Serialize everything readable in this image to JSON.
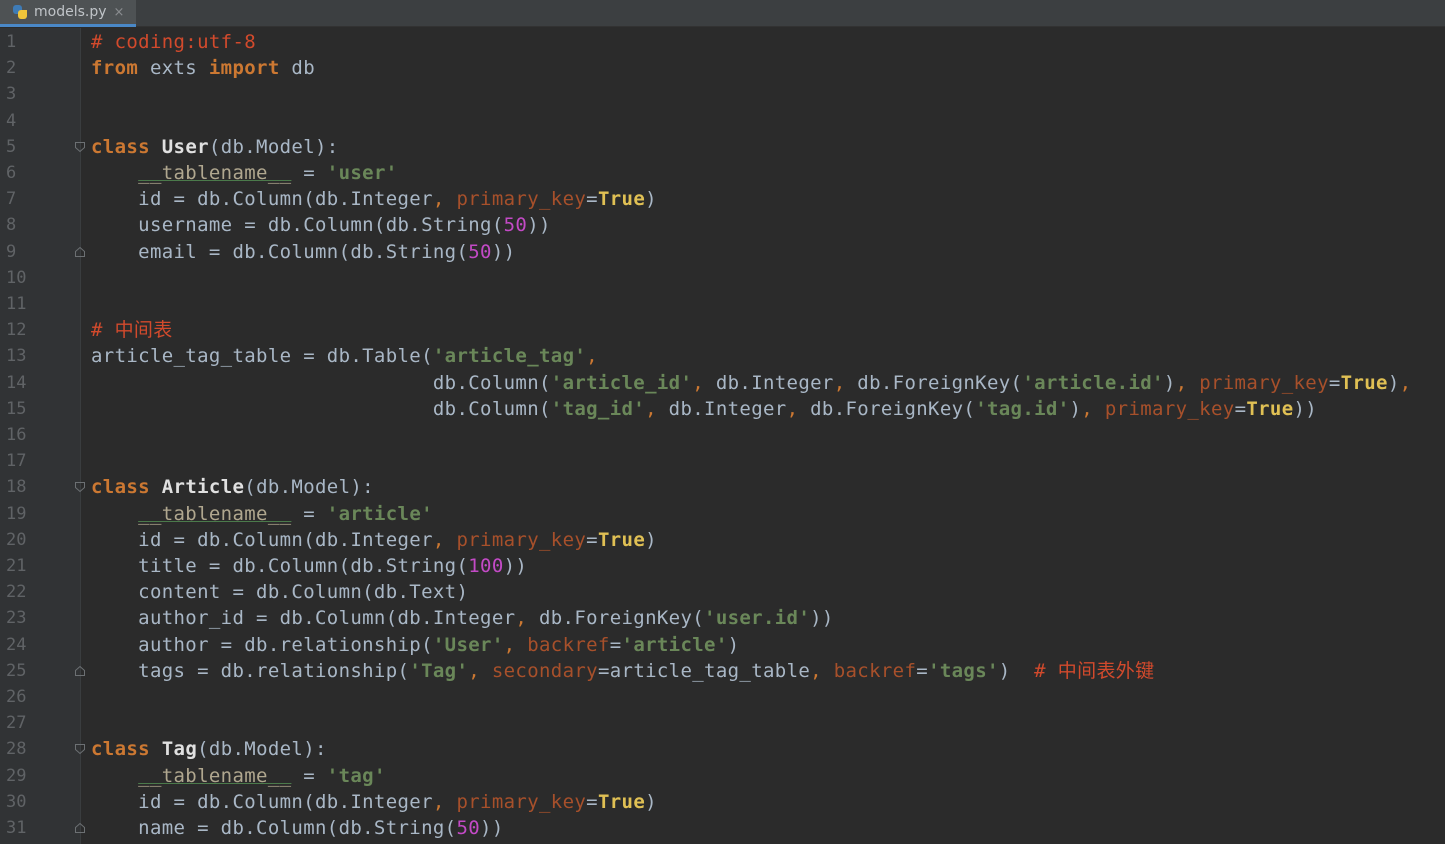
{
  "tab": {
    "filename": "models.py",
    "close_glyph": "×",
    "icon": "python-file-icon"
  },
  "colors": {
    "background": "#2b2b2b",
    "gutter": "#313335",
    "keyword": "#cc7832",
    "string": "#6a8759",
    "comment": "#d24a2c",
    "number": "#c34ac6",
    "param": "#a7502b",
    "true": "#e0c054",
    "text": "#a9b7c6"
  },
  "lines": [
    {
      "n": "1",
      "fold": "",
      "tokens": [
        [
          "cmt",
          "# coding:utf-8"
        ]
      ]
    },
    {
      "n": "2",
      "fold": "",
      "tokens": [
        [
          "kw",
          "from"
        ],
        [
          "plain",
          " exts "
        ],
        [
          "kw",
          "import"
        ],
        [
          "plain",
          " db"
        ]
      ]
    },
    {
      "n": "3",
      "fold": "",
      "tokens": []
    },
    {
      "n": "4",
      "fold": "",
      "tokens": []
    },
    {
      "n": "5",
      "fold": "open",
      "tokens": [
        [
          "kw",
          "class"
        ],
        [
          "plain",
          " "
        ],
        [
          "cls",
          "User"
        ],
        [
          "plain",
          "(db.Model):"
        ]
      ]
    },
    {
      "n": "6",
      "fold": "",
      "tokens": [
        [
          "plain",
          "    "
        ],
        [
          "dunder",
          "__tablename__"
        ],
        [
          "plain",
          " = "
        ],
        [
          "str",
          "'user'"
        ]
      ]
    },
    {
      "n": "7",
      "fold": "",
      "tokens": [
        [
          "plain",
          "    id = db.Column(db.Integer"
        ],
        [
          "comma",
          ", "
        ],
        [
          "param",
          "primary_key"
        ],
        [
          "plain",
          "="
        ],
        [
          "true",
          "True"
        ],
        [
          "plain",
          ")"
        ]
      ]
    },
    {
      "n": "8",
      "fold": "",
      "tokens": [
        [
          "plain",
          "    username = db.Column(db.String("
        ],
        [
          "num",
          "50"
        ],
        [
          "plain",
          "))"
        ]
      ]
    },
    {
      "n": "9",
      "fold": "close",
      "tokens": [
        [
          "plain",
          "    email = db.Column(db.String("
        ],
        [
          "num",
          "50"
        ],
        [
          "plain",
          "))"
        ]
      ]
    },
    {
      "n": "10",
      "fold": "",
      "tokens": []
    },
    {
      "n": "11",
      "fold": "",
      "tokens": []
    },
    {
      "n": "12",
      "fold": "",
      "tokens": [
        [
          "cmt",
          "# 中间表"
        ]
      ]
    },
    {
      "n": "13",
      "fold": "",
      "tokens": [
        [
          "plain",
          "article_tag_table = db.Table("
        ],
        [
          "str",
          "'article_tag'"
        ],
        [
          "comma",
          ","
        ]
      ]
    },
    {
      "n": "14",
      "fold": "",
      "tokens": [
        [
          "plain",
          "                             db.Column("
        ],
        [
          "str",
          "'article_id'"
        ],
        [
          "comma",
          ", "
        ],
        [
          "plain",
          "db.Integer"
        ],
        [
          "comma",
          ", "
        ],
        [
          "plain",
          "db.ForeignKey("
        ],
        [
          "str",
          "'article.id'"
        ],
        [
          "plain",
          ")"
        ],
        [
          "comma",
          ", "
        ],
        [
          "param",
          "primary_key"
        ],
        [
          "plain",
          "="
        ],
        [
          "true",
          "True"
        ],
        [
          "plain",
          ")"
        ],
        [
          "comma",
          ","
        ]
      ]
    },
    {
      "n": "15",
      "fold": "",
      "tokens": [
        [
          "plain",
          "                             db.Column("
        ],
        [
          "str",
          "'tag_id'"
        ],
        [
          "comma",
          ", "
        ],
        [
          "plain",
          "db.Integer"
        ],
        [
          "comma",
          ", "
        ],
        [
          "plain",
          "db.ForeignKey("
        ],
        [
          "str",
          "'tag.id'"
        ],
        [
          "plain",
          ")"
        ],
        [
          "comma",
          ", "
        ],
        [
          "param",
          "primary_key"
        ],
        [
          "plain",
          "="
        ],
        [
          "true",
          "True"
        ],
        [
          "plain",
          "))"
        ]
      ]
    },
    {
      "n": "16",
      "fold": "",
      "tokens": []
    },
    {
      "n": "17",
      "fold": "",
      "tokens": []
    },
    {
      "n": "18",
      "fold": "open",
      "tokens": [
        [
          "kw",
          "class"
        ],
        [
          "plain",
          " "
        ],
        [
          "cls",
          "Article"
        ],
        [
          "plain",
          "(db.Model):"
        ]
      ]
    },
    {
      "n": "19",
      "fold": "",
      "tokens": [
        [
          "plain",
          "    "
        ],
        [
          "dunder",
          "__tablename__"
        ],
        [
          "plain",
          " = "
        ],
        [
          "str",
          "'article'"
        ]
      ]
    },
    {
      "n": "20",
      "fold": "",
      "tokens": [
        [
          "plain",
          "    id = db.Column(db.Integer"
        ],
        [
          "comma",
          ", "
        ],
        [
          "param",
          "primary_key"
        ],
        [
          "plain",
          "="
        ],
        [
          "true",
          "True"
        ],
        [
          "plain",
          ")"
        ]
      ]
    },
    {
      "n": "21",
      "fold": "",
      "tokens": [
        [
          "plain",
          "    title = db.Column(db.String("
        ],
        [
          "num",
          "100"
        ],
        [
          "plain",
          "))"
        ]
      ]
    },
    {
      "n": "22",
      "fold": "",
      "tokens": [
        [
          "plain",
          "    content = db.Column(db.Text)"
        ]
      ]
    },
    {
      "n": "23",
      "fold": "",
      "tokens": [
        [
          "plain",
          "    author_id = db.Column(db.Integer"
        ],
        [
          "comma",
          ", "
        ],
        [
          "plain",
          "db.ForeignKey("
        ],
        [
          "str",
          "'user.id'"
        ],
        [
          "plain",
          "))"
        ]
      ]
    },
    {
      "n": "24",
      "fold": "",
      "tokens": [
        [
          "plain",
          "    author = db.relationship("
        ],
        [
          "str",
          "'User'"
        ],
        [
          "comma",
          ", "
        ],
        [
          "param",
          "backref"
        ],
        [
          "plain",
          "="
        ],
        [
          "str",
          "'article'"
        ],
        [
          "plain",
          ")"
        ]
      ]
    },
    {
      "n": "25",
      "fold": "close",
      "tokens": [
        [
          "plain",
          "    tags = db.relationship("
        ],
        [
          "str",
          "'Tag'"
        ],
        [
          "comma",
          ", "
        ],
        [
          "param",
          "secondary"
        ],
        [
          "plain",
          "=article_tag_table"
        ],
        [
          "comma",
          ", "
        ],
        [
          "param",
          "backref"
        ],
        [
          "plain",
          "="
        ],
        [
          "str",
          "'tags'"
        ],
        [
          "plain",
          ")  "
        ],
        [
          "cmt",
          "# 中间表外键"
        ]
      ]
    },
    {
      "n": "26",
      "fold": "",
      "tokens": []
    },
    {
      "n": "27",
      "fold": "",
      "tokens": []
    },
    {
      "n": "28",
      "fold": "open",
      "tokens": [
        [
          "kw",
          "class"
        ],
        [
          "plain",
          " "
        ],
        [
          "cls",
          "Tag"
        ],
        [
          "plain",
          "(db.Model):"
        ]
      ]
    },
    {
      "n": "29",
      "fold": "",
      "tokens": [
        [
          "plain",
          "    "
        ],
        [
          "dunder",
          "__tablename__"
        ],
        [
          "plain",
          " = "
        ],
        [
          "str",
          "'tag'"
        ]
      ]
    },
    {
      "n": "30",
      "fold": "",
      "tokens": [
        [
          "plain",
          "    id = db.Column(db.Integer"
        ],
        [
          "comma",
          ", "
        ],
        [
          "param",
          "primary_key"
        ],
        [
          "plain",
          "="
        ],
        [
          "true",
          "True"
        ],
        [
          "plain",
          ")"
        ]
      ]
    },
    {
      "n": "31",
      "fold": "close",
      "tokens": [
        [
          "plain",
          "    name = db.Column(db.String("
        ],
        [
          "num",
          "50"
        ],
        [
          "plain",
          "))"
        ]
      ]
    }
  ]
}
